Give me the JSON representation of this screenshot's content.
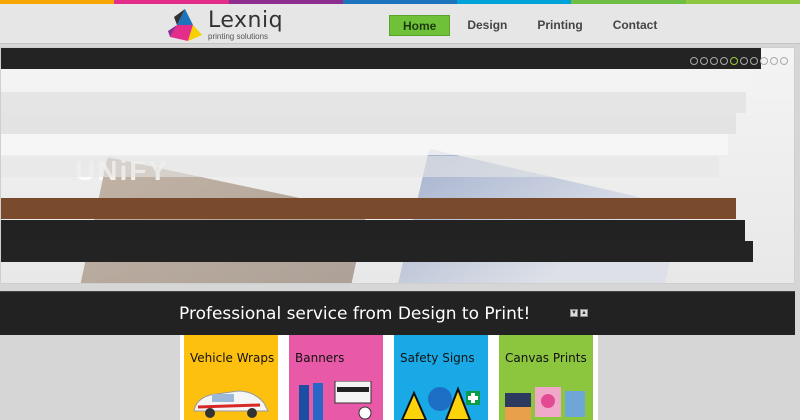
{
  "colors": {
    "top_stripes": [
      "#f7a600",
      "#e42d8a",
      "#8c2d8f",
      "#1c75bc",
      "#00a3d9",
      "#6fbe44",
      "#8dc63f"
    ],
    "accent_green": "#6fc13a",
    "band_dark": "#222222"
  },
  "brand": {
    "name": "Lexniq",
    "tagline": "printing solutions",
    "icon": "lexniq-logo-icon"
  },
  "nav": {
    "items": [
      {
        "label": "Home",
        "active": true
      },
      {
        "label": "Design",
        "active": false
      },
      {
        "label": "Printing",
        "active": false
      },
      {
        "label": "Contact",
        "active": false
      }
    ]
  },
  "slider": {
    "dot_count": 10,
    "active_dot": 5,
    "watermark": "UNiFY"
  },
  "banner": {
    "headline": "Professional service from Design to Print!"
  },
  "tiles": [
    {
      "label": "Vehicle Wraps",
      "color": "#fec00f"
    },
    {
      "label": "Banners",
      "color": "#e85aa8"
    },
    {
      "label": "Safety Signs",
      "color": "#19a9e6"
    },
    {
      "label": "Canvas Prints",
      "color": "#8cc63f"
    }
  ]
}
